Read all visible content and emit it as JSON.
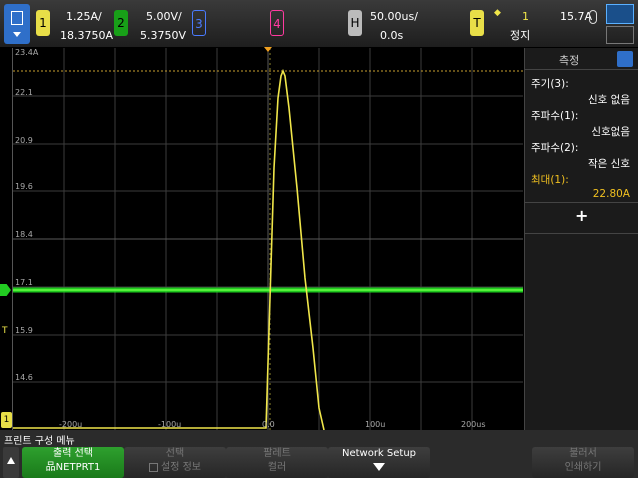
{
  "top": {
    "ch1": {
      "num": "1",
      "scale": "1.25A/",
      "offset": "18.3750A",
      "color": "#f0e64a"
    },
    "ch2": {
      "num": "2",
      "scale": "5.00V/",
      "offset": "5.3750V",
      "color": "#22cc22"
    },
    "ch3": {
      "num": "3",
      "color": "#4a7bff"
    },
    "ch4": {
      "num": "4",
      "color": "#ff3aa0"
    },
    "horiz": {
      "label": "H",
      "timebase": "50.00us/",
      "delay": "0.0s"
    },
    "trigger": {
      "label": "T",
      "source": "1",
      "level": "15.7A",
      "state": "정지"
    }
  },
  "scope": {
    "y_labels": [
      "23.4A",
      "22.1",
      "20.9",
      "19.6",
      "18.4",
      "17.1",
      "15.9",
      "14.6"
    ],
    "x_labels": [
      "-200u",
      "-100u",
      "0.0",
      "100u",
      "200us"
    ]
  },
  "meas": {
    "title": "측정",
    "items": [
      {
        "label": "주기(3):",
        "value": "신호 없음",
        "color": "#ffffff"
      },
      {
        "label": "주파수(1):",
        "value": "신호없음",
        "color": "#ffffff"
      },
      {
        "label": "주파수(2):",
        "value": "작은 신호",
        "color": "#ffffff"
      },
      {
        "label": "최대(1):",
        "value": "22.80A",
        "color": "#f0c020"
      }
    ],
    "add": "+"
  },
  "menu": {
    "title": "프린트 구성 메뉴",
    "keys": [
      {
        "line1": "출력 선택",
        "line2": "NETPRT1"
      },
      {
        "line1": "선택",
        "line2": "설정 정보"
      },
      {
        "line1": "팔레트",
        "line2": "컬러"
      },
      {
        "line1": "Network Setup",
        "line2": ""
      },
      {
        "line1": "불러서",
        "line2": "인쇄하기"
      }
    ]
  }
}
